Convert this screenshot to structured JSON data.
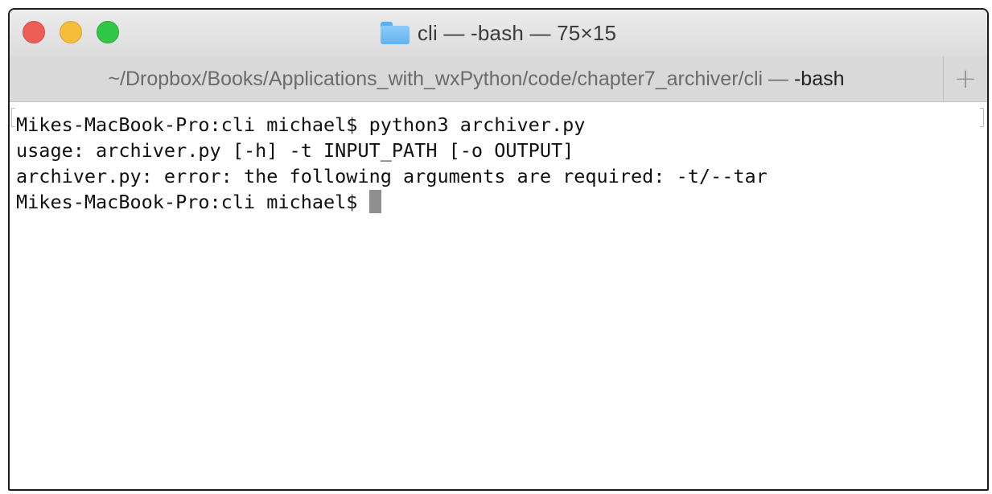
{
  "window": {
    "title": "cli — -bash — 75×15",
    "title_icon": "folder-icon",
    "buttons": {
      "close_color": "#ed5e57",
      "minimize_color": "#f5bd3a",
      "maximize_color": "#33c748"
    }
  },
  "tab": {
    "path": "~/Dropbox/Books/Applications_with_wxPython/code/chapter7_archiver/cli — ",
    "command": "-bash",
    "new_tab_label": "+"
  },
  "terminal": {
    "lines": [
      "Mikes-MacBook-Pro:cli michael$ python3 archiver.py",
      "usage: archiver.py [-h] -t INPUT_PATH [-o OUTPUT]",
      "archiver.py: error: the following arguments are required: -t/--tar"
    ],
    "prompt": "Mikes-MacBook-Pro:cli michael$ ",
    "cursor_color": "#8f8f8f"
  }
}
